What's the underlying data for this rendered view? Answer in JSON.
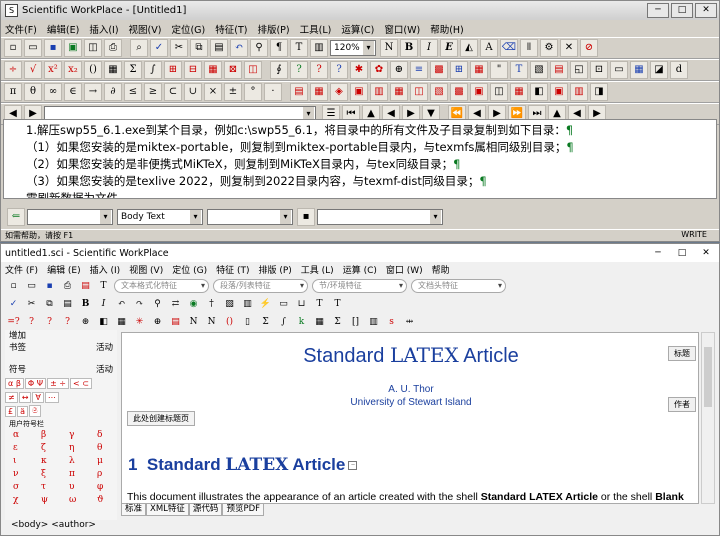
{
  "top_window": {
    "title": "Scientific WorkPlace - [Untitled1]",
    "menu": [
      "文件(F)",
      "编辑(E)",
      "插入(I)",
      "视图(V)",
      "定位(G)",
      "特征(T)",
      "排版(P)",
      "工具(L)",
      "运算(C)",
      "窗口(W)",
      "帮助(H)"
    ],
    "zoom": "120%",
    "doc_lines": [
      "1.解压swp55_6.1.exe到某个目录，例如c:\\swp55_6.1，将目录中的所有文件及子目录复制到如下目录：",
      "（1）如果您安装的是miktex-portable，则复制到miktex-portable目录内，与texmfs属相同级别目录；",
      "（2）如果您安装的是非便携式MiKTeX，则复制到MiKTeX目录内，与tex同级目录；",
      "（3）如果您安装的是texlive 2022，则复制到2022目录内容，与texmf-dist同级目录；",
      "需刷新数据为文件"
    ],
    "pilcrow": "¶",
    "style_combo": "Body Text",
    "status_left": "如需帮助，请按 F1",
    "status_right": "WRITE"
  },
  "bottom_window": {
    "title": "untitled1.sci - Scientific WorkPlace",
    "menu": [
      "文件 (F)",
      "编辑 (E)",
      "插入 (I)",
      "视图 (V)",
      "定位 (G)",
      "特征 (T)",
      "排版 (P)",
      "工具 (L)",
      "运算 (C)",
      "窗口 (W)",
      "帮助"
    ],
    "pills": [
      "文本格式化特征",
      "段落/列表特征",
      "节/环境特征",
      "文档头特征"
    ],
    "sidebar": {
      "add_label": "增加",
      "bookmark_label": "书签",
      "activity_label": "活动",
      "symbol_label": "符号",
      "tabs": [
        "α β",
        "Φ Ψ",
        "± ÷",
        "< ⊂"
      ],
      "user_symbol_label": "用户符号栏",
      "greek": [
        "α",
        "β",
        "γ",
        "δ",
        "ε",
        "ζ",
        "η",
        "θ",
        "ι",
        "κ",
        "λ",
        "μ",
        "ν",
        "ξ",
        "π",
        "ρ",
        "σ",
        "τ",
        "υ",
        "φ",
        "χ",
        "ψ",
        "ω",
        "ϑ"
      ]
    },
    "article": {
      "title_prefix": "Standard ",
      "title_suffix": " Article",
      "latex": "LATEX",
      "title_chip": "标题",
      "author_chip": "作者",
      "author_name": "A. U. Thor",
      "affiliation": "University of Stewart Island",
      "maketitle_button": "此处创建标题页",
      "section_number": "1",
      "section_prefix": "Standard ",
      "section_suffix": " Article",
      "para_prefix": "This document illustrates the appearance of an article created with the shell ",
      "para_bold": "Standard LATEX Article",
      "para_suffix": " or the shell ",
      "para_bold2": "Blank"
    },
    "bottom_tabs": [
      "标准",
      "XML特征",
      "源代码",
      "预览PDF"
    ],
    "status": "<body> <author>"
  }
}
